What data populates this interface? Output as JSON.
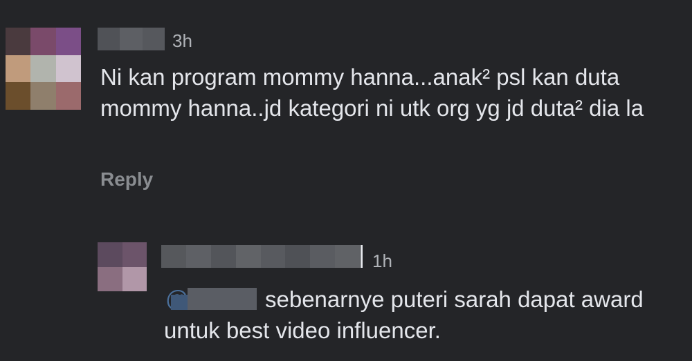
{
  "comment": {
    "timestamp": "3h",
    "text": "Ni kan program mommy hanna...anak² psl kan duta mommy hanna..jd kategori ni utk org yg jd duta² dia la",
    "reply_label": "Reply",
    "avatar_colors": [
      "#4a3a3e",
      "#7a4a6a",
      "#7b4e87",
      "#c09b7c",
      "#b1b4ad",
      "#d0c3cf",
      "#6b4e2c",
      "#8f7f6c",
      "#9b6a6c"
    ],
    "name_blur_colors": [
      "#505257",
      "#5d5f64",
      "#56585d"
    ]
  },
  "reply": {
    "timestamp": "1h",
    "mention_ghost": "@Shaik",
    "text": "sebenarnye puteri sarah dapat award untuk best video influencer.",
    "avatar_colors": [
      "#5c4a5e",
      "#6c546a",
      "#8a6e80",
      "#b197a8"
    ],
    "name_blur_colors": [
      "#56585c",
      "#5e6065",
      "#53555a",
      "#616367",
      "#585a5f",
      "#4f5156",
      "#5a5c61",
      "#606266"
    ]
  }
}
